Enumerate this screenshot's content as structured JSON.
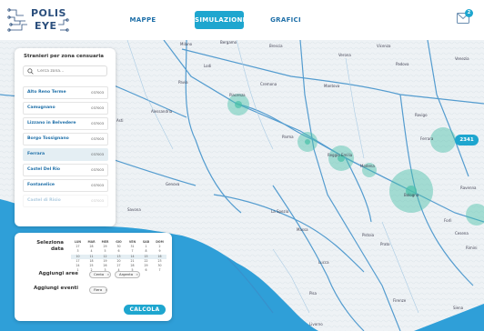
{
  "app": {
    "logo_line1": "POLIS",
    "logo_line2": "EYE"
  },
  "nav": {
    "mappe": "MAPPE",
    "simulazioni": "SIMULAZIONI",
    "grafici": "GRAFICI"
  },
  "messages": {
    "count": "2"
  },
  "zone_panel": {
    "title": "Stranieri per zona censuaria",
    "search_placeholder": "Cerca zona...",
    "items": [
      {
        "name": "Alto Reno Terme",
        "code": "037003"
      },
      {
        "name": "Camugnano",
        "code": "037003"
      },
      {
        "name": "Lizzano in Belvedere",
        "code": "037003"
      },
      {
        "name": "Borgo Tossignano",
        "code": "037003"
      },
      {
        "name": "Ferrara",
        "code": "037003"
      },
      {
        "name": "Castel Del Rio",
        "code": "037003"
      },
      {
        "name": "Fontanelice",
        "code": "037003"
      },
      {
        "name": "Castel di Risio",
        "code": "037003"
      }
    ]
  },
  "date_panel": {
    "select_date_label": "Seleziona data",
    "calendar": {
      "days": [
        "LUN",
        "MAR",
        "MER",
        "GIO",
        "VEN",
        "SAB",
        "DOM"
      ],
      "weeks": [
        [
          "27",
          "28",
          "29",
          "30",
          "31",
          "1",
          "2"
        ],
        [
          "3",
          "4",
          "5",
          "6",
          "7",
          "8",
          "9"
        ],
        [
          "10",
          "11",
          "12",
          "13",
          "14",
          "15",
          "16"
        ],
        [
          "17",
          "18",
          "19",
          "20",
          "21",
          "22",
          "23"
        ],
        [
          "24",
          "25",
          "26",
          "27",
          "28",
          "29",
          "30"
        ],
        [
          "1",
          "2",
          "3",
          "4",
          "5",
          "6",
          "7"
        ]
      ]
    },
    "aree_label": "Aggiungi aree",
    "aree_chips": [
      "Cento",
      "Argenta"
    ],
    "eventi_label": "Aggiungi eventi",
    "eventi_chips": [
      "Fiera"
    ],
    "chip_remove": "×",
    "calcola": "CALCOLA"
  },
  "map": {
    "cluster_count": "2341",
    "cities": [
      "Milano",
      "Brescia",
      "Verona",
      "Padova",
      "Vicenza",
      "Venezia",
      "Bergamo",
      "Lodi",
      "Pavia",
      "Piacenza",
      "Cremona",
      "Mantova",
      "Parma",
      "Reggio Emilia",
      "Modena",
      "Bologna",
      "Ferrara",
      "Rovigo",
      "Ravenna",
      "Genova",
      "Alessandria",
      "Asti",
      "Savona",
      "La Spezia",
      "Massa",
      "Pistoia",
      "Prato",
      "Firenze",
      "Lucca",
      "Pisa",
      "Livorno",
      "Siena",
      "Forlì",
      "Cesena",
      "Rimini"
    ]
  }
}
